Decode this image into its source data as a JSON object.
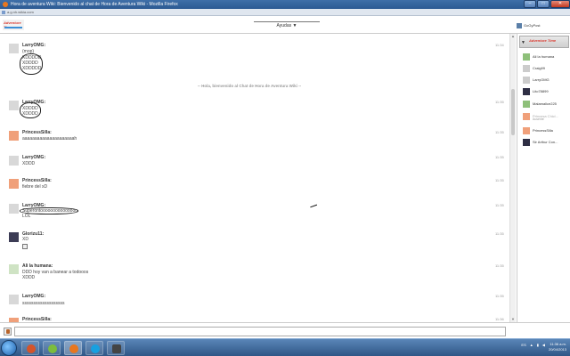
{
  "window": {
    "title": "Hora de aventura Wiki: Bienvenido al chat de Hora de Aventura Wiki - Mozilla Firefox",
    "url": "a.g.nh.wikia.com"
  },
  "header": {
    "logo_text": "Adventure Time",
    "help_label": "Ayudas ▼",
    "self_username": "GoGyPost"
  },
  "chat": {
    "welcome": "-- Hola, bienvenido al Chat de Hora de Aventura Wiki --",
    "messages": [
      {
        "user": "LarryOMG:",
        "time": "11:34",
        "lines": [
          "(mop)",
          "XDDDDD",
          "XDDDD",
          "XDDDDD"
        ]
      },
      {
        "user": "LarryOMG:",
        "time": "11:35",
        "lines": [
          "XDDDD",
          "XDDDD"
        ]
      },
      {
        "user": "PrincessSilla:",
        "time": "11:35",
        "lines": [
          "aaaaaaaaaaaaaaaaaaaaah"
        ]
      },
      {
        "user": "LarryOMG:",
        "time": "11:35",
        "lines": [
          "XDDD"
        ]
      },
      {
        "user": "PrincessSilla:",
        "time": "11:35",
        "lines": [
          "fiebre del xD"
        ]
      },
      {
        "user": "LarryOMG:",
        "time": "11:35",
        "lines": [
          "Superontooooooooooooooo",
          "LOL"
        ]
      },
      {
        "user": "Glorizu11:",
        "time": "11:35",
        "lines": [
          "XD"
        ]
      },
      {
        "user": "Ali la humana:",
        "time": "11:35",
        "lines": [
          "DDD hoy van a banear a todooos",
          "XDDD"
        ]
      },
      {
        "user": "LarryOMG:",
        "time": "11:35",
        "lines": [
          "sssssssssssssssssss"
        ]
      },
      {
        "user": "PrincessSilla:",
        "time": "11:36",
        "lines": []
      }
    ]
  },
  "sidebar": {
    "users": [
      {
        "name": "Ali la humana",
        "sub": ""
      },
      {
        "name": "Craig99",
        "sub": ""
      },
      {
        "name": "LarryOMG",
        "sub": ""
      },
      {
        "name": "Lito78899",
        "sub": ""
      },
      {
        "name": "Malamalice225",
        "sub": ""
      },
      {
        "name": "Princesa Chicl...",
        "sub": "Ausente"
      },
      {
        "name": "PrincessSilla",
        "sub": ""
      },
      {
        "name": "Sir Arthur Con...",
        "sub": ""
      }
    ]
  },
  "taskbar": {
    "tray_lang": "ES",
    "time": "11:36 a.m.",
    "date": "20/04/2013"
  },
  "colors": {
    "titlebar": "#2c5a92",
    "taskbar": "#2f5686",
    "logo_red": "#d83a30"
  }
}
